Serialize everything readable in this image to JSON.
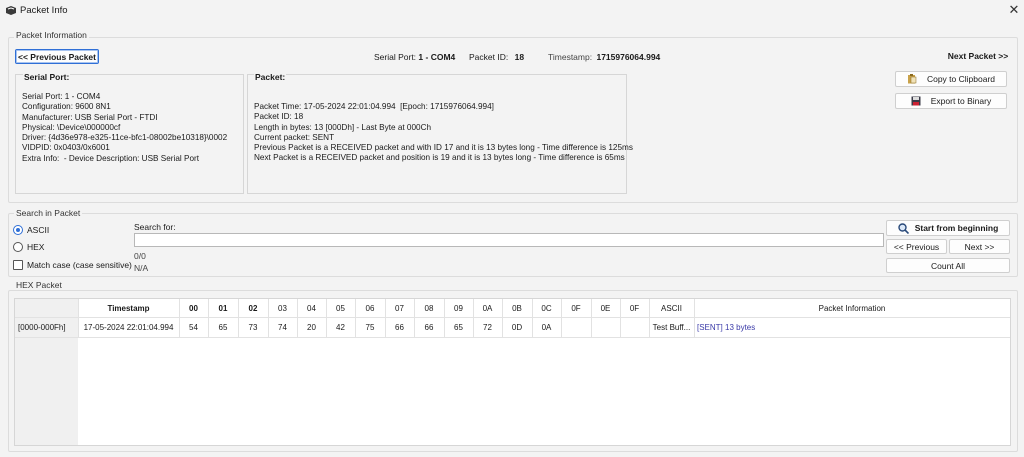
{
  "window": {
    "title": "Packet Info",
    "close_glyph": "✕"
  },
  "packet_info_group": {
    "label": "Packet Information",
    "prev_button": "<< Previous Packet",
    "next_button": "Next Packet >>",
    "serial_port_label": "Serial Port:",
    "serial_port_value": "1 - COM4",
    "packet_id_label": "Packet ID:",
    "packet_id_value": "18",
    "timestamp_label": "Timestamp:",
    "timestamp_value": "1715976064.994",
    "copy_button": "Copy to Clipboard",
    "export_button": "Export to Binary"
  },
  "serial_panel": {
    "heading": "Serial Port:",
    "lines": [
      "Serial Port: 1 - COM4",
      "Configuration: 9600 8N1",
      "Manufacturer: USB Serial Port - FTDI",
      "Physical: \\Device\\000000cf",
      "Driver: {4d36e978-e325-11ce-bfc1-08002be10318}\\0002",
      "VIDPID: 0x0403/0x6001",
      "Extra Info:  - Device Description: USB Serial Port"
    ]
  },
  "packet_panel": {
    "heading": "Packet:",
    "lines": [
      "Packet Time: 17-05-2024 22:01:04.994  [Epoch: 1715976064.994]",
      "Packet ID: 18",
      "Length in bytes: 13 [000Dh] - Last Byte at 000Ch",
      "Current packet: SENT",
      "Previous Packet is a RECEIVED packet and with ID 17 and it is 13 bytes long - Time difference is 125ms",
      "Next Packet is a RECEIVED packet and position is 19 and it is 13 bytes long - Time difference is 65ms"
    ]
  },
  "search_group": {
    "label": "Search in Packet",
    "ascii_label": "ASCII",
    "hex_label": "HEX",
    "match_case_label": "Match case (case sensitive)",
    "search_for_label": "Search for:",
    "search_value": "",
    "count_text": "0/0",
    "status_text": "N/A",
    "start_button": "Start from beginning",
    "prev_button": "<< Previous",
    "next_button": "Next >>",
    "count_all_button": "Count All",
    "ascii_selected": true,
    "match_case_checked": false
  },
  "hex_group": {
    "label": "HEX Packet",
    "headers": [
      "Timestamp",
      "00",
      "01",
      "02",
      "03",
      "04",
      "05",
      "06",
      "07",
      "08",
      "09",
      "0A",
      "0B",
      "0C",
      "0F",
      "0E",
      "0F",
      "ASCII",
      "Packet Information"
    ],
    "row": {
      "range": "[0000-000Fh]",
      "timestamp": "17-05-2024 22:01:04.994",
      "bytes": [
        "54",
        "65",
        "73",
        "74",
        "20",
        "42",
        "75",
        "66",
        "66",
        "65",
        "72",
        "0D",
        "0A",
        "",
        "",
        ""
      ],
      "ascii": "Test Buff...",
      "info": "[SENT] 13 bytes"
    }
  },
  "colors": {
    "accent": "#2f6fd6",
    "info_link": "#3a3aa8"
  }
}
